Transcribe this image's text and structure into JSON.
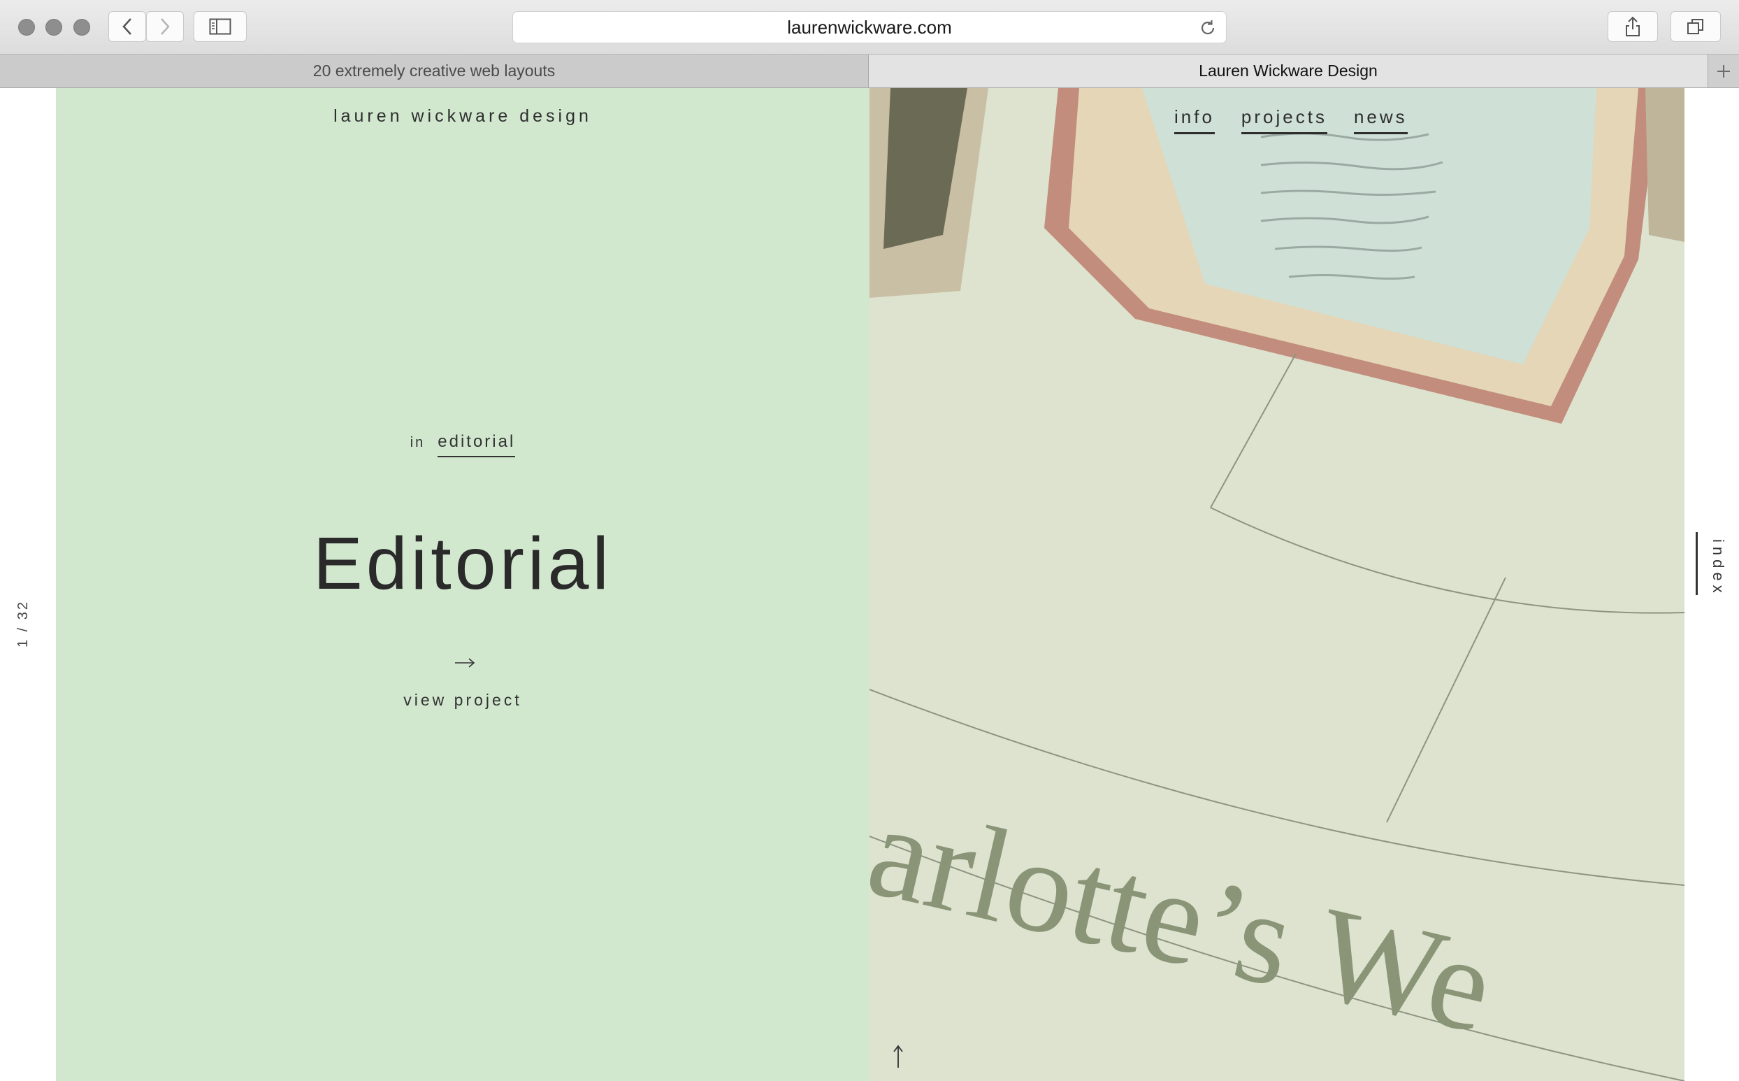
{
  "browser": {
    "url": "laurenwickware.com",
    "tabs": [
      {
        "label": "20 extremely creative web layouts",
        "active": false
      },
      {
        "label": "Lauren Wickware Design",
        "active": true
      }
    ],
    "icons": {
      "back": "chevron-left-icon",
      "forward": "chevron-right-icon",
      "sidebar": "sidebar-icon",
      "reload": "reload-icon",
      "share": "share-icon",
      "tabs": "tab-overview-icon",
      "new_tab": "plus-icon"
    }
  },
  "site": {
    "logo": "lauren wickware design",
    "nav": [
      "info",
      "projects",
      "news"
    ],
    "counter": "1 / 32",
    "category_prefix": "in",
    "category": "editorial",
    "headline": "Editorial",
    "cta": "view project",
    "side_link": "index",
    "photo_text": "arlotte’s We",
    "colors": {
      "panel_green": "#d1e8cf",
      "text": "#2b2b2b"
    }
  }
}
